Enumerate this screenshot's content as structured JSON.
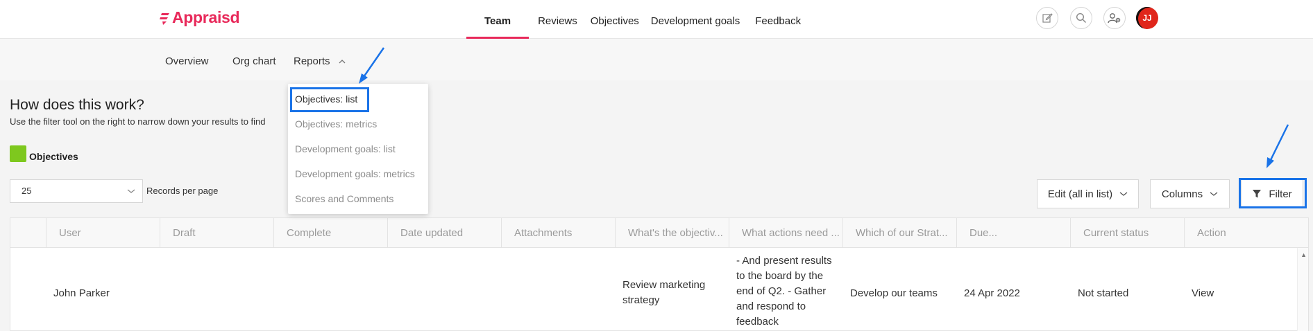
{
  "brand": {
    "name": "Appraisd",
    "color": "#e8295a"
  },
  "nav": {
    "items": [
      {
        "label": "Team"
      },
      {
        "label": "Reviews"
      },
      {
        "label": "Objectives"
      },
      {
        "label": "Development goals"
      },
      {
        "label": "Feedback"
      }
    ],
    "active": "Team"
  },
  "header_icons": [
    "edit-icon",
    "search-icon",
    "user-settings-icon"
  ],
  "user": {
    "initials": "JJ"
  },
  "subnav": {
    "overview": "Overview",
    "org_chart": "Org chart",
    "reports": "Reports"
  },
  "reports_menu": {
    "items": [
      "Objectives: list",
      "Objectives: metrics",
      "Development goals: list",
      "Development goals: metrics",
      "Scores and Comments"
    ]
  },
  "intro": {
    "heading": "How does this work?",
    "text": "Use the filter tool on the right to narrow down your results to find"
  },
  "legend": {
    "label": "Objectives",
    "color": "#7ec81e"
  },
  "records": {
    "value": "25",
    "label": "Records per page"
  },
  "toolbar": {
    "edit_label": "Edit (all in list)",
    "columns_label": "Columns",
    "filter_label": "Filter"
  },
  "table": {
    "columns": [
      "User",
      "Draft",
      "Complete",
      "Date updated",
      "Attachments",
      "What's the objectiv...",
      "What actions need ...",
      "Which of our Strat...",
      "Due...",
      "Current status",
      "Action"
    ],
    "rows": [
      {
        "user": "John Parker",
        "draft": "",
        "complete": "",
        "date_updated": "",
        "attachments": "",
        "objective": "Review marketing strategy",
        "actions": "- And present results to the board by the end of Q2. - Gather and respond to feedback",
        "strategy": "Develop our teams",
        "due": "24 Apr 2022",
        "status": "Not started",
        "action": "View"
      }
    ]
  },
  "annotation_color": "#1a73e8"
}
